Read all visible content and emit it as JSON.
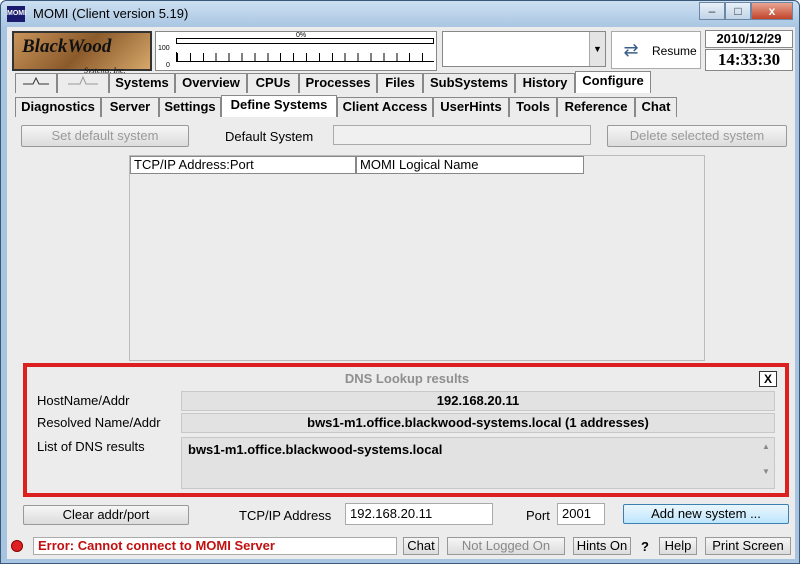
{
  "window": {
    "title": "MOMI (Client version 5.19)",
    "app_icon": "MOMI",
    "min": "–",
    "max": "□",
    "close": "x"
  },
  "header": {
    "logo_text": "BlackWood",
    "logo_sub": "Systems, Inc.",
    "meter": {
      "pct": "0%",
      "label_100": "100",
      "label_0": "0"
    },
    "combo_arrow": "▼",
    "resume_label": "Resume",
    "date": "2010/12/29",
    "time": "14:33:30"
  },
  "main_tabs": [
    "Systems",
    "Overview",
    "CPUs",
    "Processes",
    "Files",
    "SubSystems",
    "History",
    "Configure"
  ],
  "main_tab_icons": [
    "pulse-icon",
    "pulse-flat-icon"
  ],
  "sub_tabs": [
    "Diagnostics",
    "Server",
    "Settings",
    "Define Systems",
    "Client Access",
    "UserHints",
    "Tools",
    "Reference",
    "Chat"
  ],
  "define": {
    "set_default_btn": "Set default system",
    "default_label": "Default System",
    "default_value": "",
    "delete_btn": "Delete selected system",
    "col_addr": "TCP/IP Address:Port",
    "col_name": "MOMI Logical Name"
  },
  "dns": {
    "title": "DNS Lookup results",
    "close": "X",
    "host_label": "HostName/Addr",
    "host_value": "192.168.20.11",
    "resolved_label": "Resolved Name/Addr",
    "resolved_value": "bws1-m1.office.blackwood-systems.local  (1 addresses)",
    "list_label": "List of DNS results",
    "list_value": "bws1-m1.office.blackwood-systems.local",
    "scroll_up": "▲",
    "scroll_down": "▼"
  },
  "form": {
    "clear_btn": "Clear addr/port",
    "addr_label": "TCP/IP Address",
    "addr_value": "192.168.20.11",
    "port_label": "Port",
    "port_value": "2001",
    "add_btn": "Add new system ..."
  },
  "status": {
    "error": "Error: Cannot connect to MOMI Server",
    "chat": "Chat",
    "login": "Not Logged On",
    "hints": "Hints On",
    "help_q": "?",
    "help": "Help",
    "print": "Print Screen"
  }
}
